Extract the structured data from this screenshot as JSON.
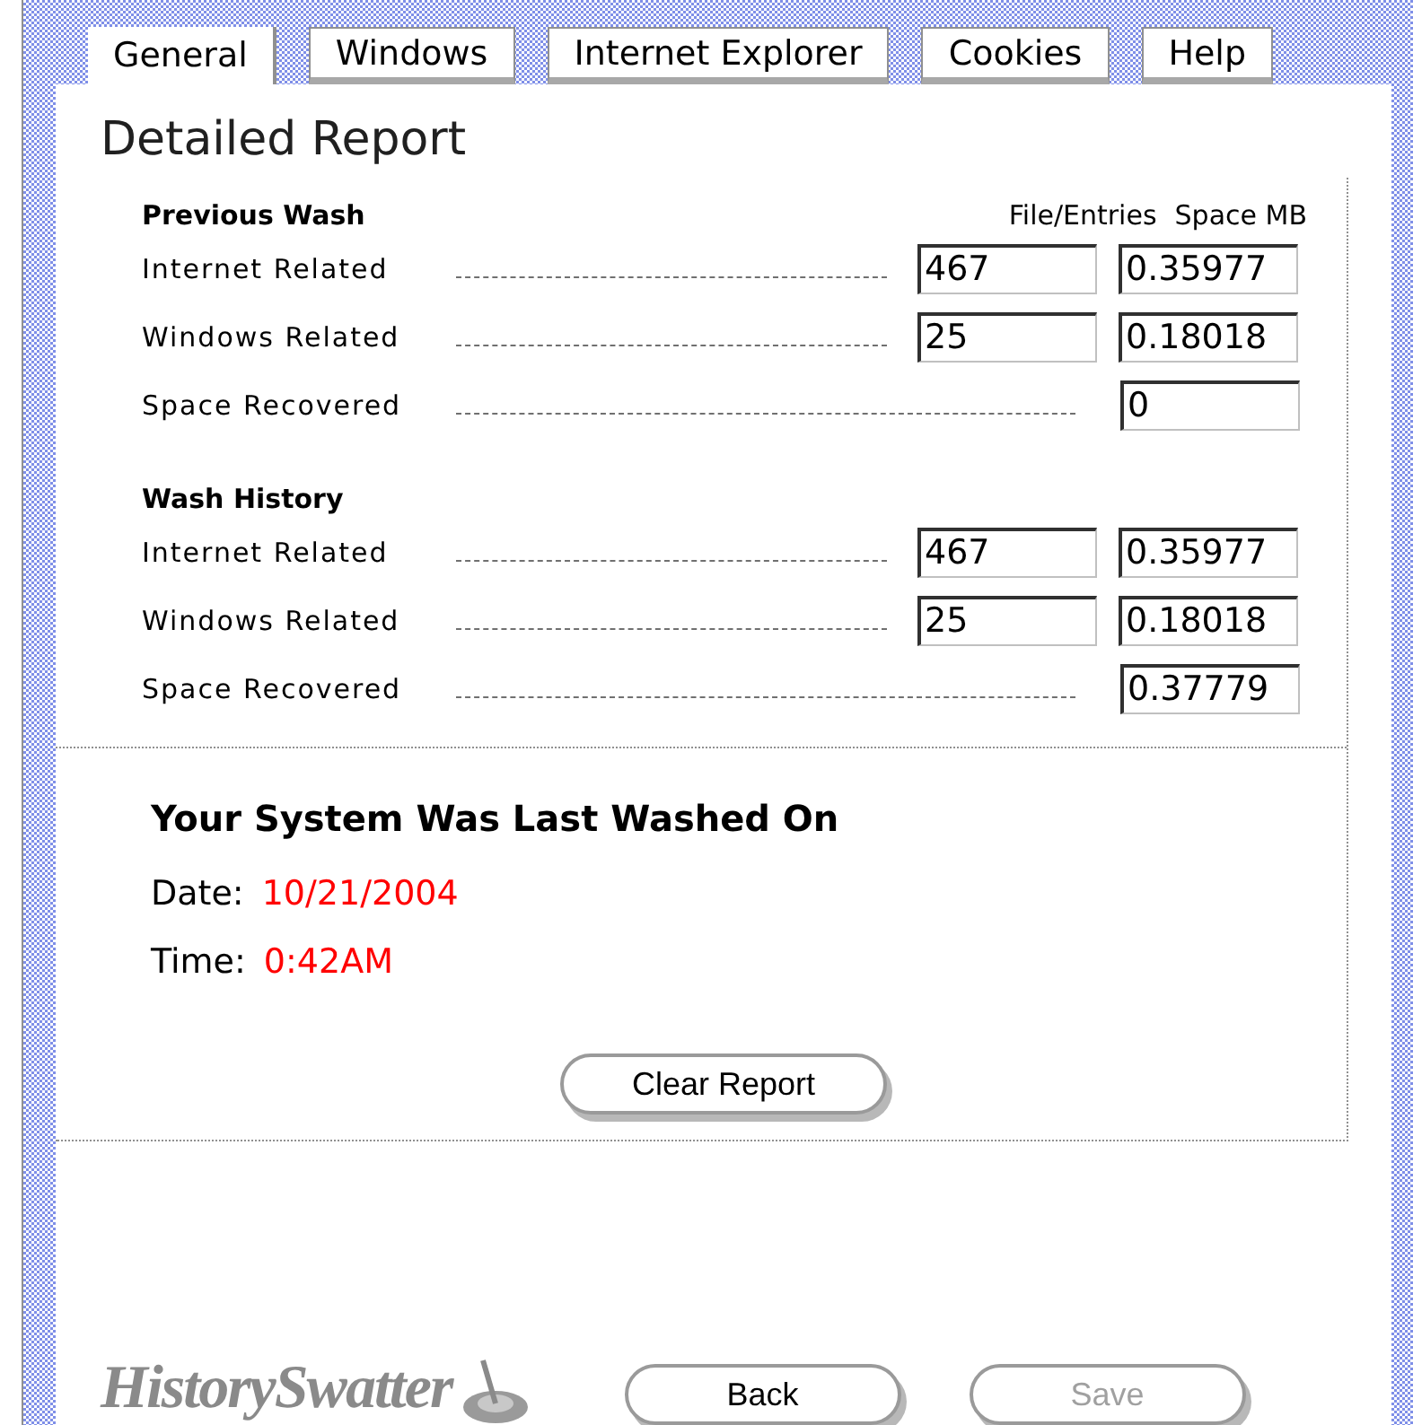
{
  "tabs": [
    {
      "label": "General",
      "selected": true
    },
    {
      "label": "Windows",
      "selected": false
    },
    {
      "label": "Internet Explorer",
      "selected": false
    },
    {
      "label": "Cookies",
      "selected": false
    },
    {
      "label": "Help",
      "selected": false
    }
  ],
  "title": "Detailed Report",
  "columns": [
    "File/Entries",
    "Space MB"
  ],
  "sections": [
    {
      "heading": "Previous Wash",
      "rows": [
        {
          "label": "Internet Related",
          "files": "467",
          "space": "0.35977"
        },
        {
          "label": "Windows Related",
          "files": "25",
          "space": "0.18018"
        },
        {
          "label": "Space Recovered",
          "space": "0"
        }
      ]
    },
    {
      "heading": "Wash History",
      "rows": [
        {
          "label": "Internet Related",
          "files": "467",
          "space": "0.35977"
        },
        {
          "label": "Windows Related",
          "files": "25",
          "space": "0.18018"
        },
        {
          "label": "Space Recovered",
          "space": "0.37779"
        }
      ]
    }
  ],
  "last_washed": {
    "heading": "Your System Was Last Washed On",
    "date_label": "Date:",
    "date": "10/21/2004",
    "time_label": "Time:",
    "time": "0:42AM"
  },
  "clear_button": "Clear Report",
  "logo": "HistorySwatter",
  "buttons": [
    {
      "label": "Back",
      "disabled": false
    },
    {
      "label": "Save",
      "disabled": true
    }
  ]
}
